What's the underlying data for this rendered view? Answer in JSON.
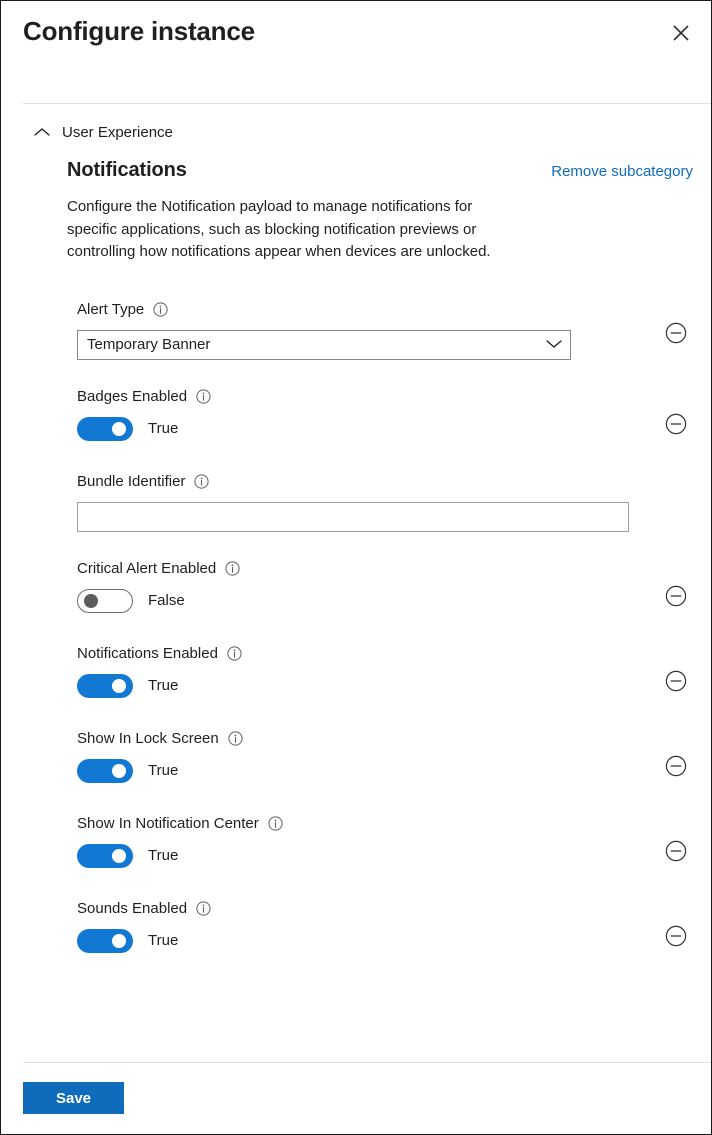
{
  "panel": {
    "title": "Configure instance",
    "close_icon": "close-icon"
  },
  "category": {
    "label": "User Experience",
    "collapse_icon": "chevron-up-icon",
    "expanded": true
  },
  "subcategory": {
    "title": "Notifications",
    "remove_link": "Remove subcategory",
    "description": "Configure the Notification payload to manage notifications for specific applications, such as blocking notification previews or controlling how notifications appear when devices are unlocked."
  },
  "settings": [
    {
      "label": "Alert Type",
      "info_icon": "info-icon",
      "type": "dropdown",
      "value": "Temporary Banner",
      "chevron_icon": "chevron-down-icon",
      "removable": true,
      "remove_icon": "circle-minus-icon"
    },
    {
      "label": "Badges Enabled",
      "info_icon": "info-icon",
      "type": "toggle",
      "value": "True",
      "on": true,
      "removable": true,
      "remove_icon": "circle-minus-icon"
    },
    {
      "label": "Bundle Identifier",
      "info_icon": "info-icon",
      "type": "text",
      "value": "",
      "placeholder": "",
      "removable": false
    },
    {
      "label": "Critical Alert Enabled",
      "info_icon": "info-icon",
      "type": "toggle",
      "value": "False",
      "on": false,
      "removable": true,
      "remove_icon": "circle-minus-icon"
    },
    {
      "label": "Notifications Enabled",
      "info_icon": "info-icon",
      "type": "toggle",
      "value": "True",
      "on": true,
      "removable": true,
      "remove_icon": "circle-minus-icon"
    },
    {
      "label": "Show In Lock Screen",
      "info_icon": "info-icon",
      "type": "toggle",
      "value": "True",
      "on": true,
      "removable": true,
      "remove_icon": "circle-minus-icon"
    },
    {
      "label": "Show In Notification Center",
      "info_icon": "info-icon",
      "type": "toggle",
      "value": "True",
      "on": true,
      "removable": true,
      "remove_icon": "circle-minus-icon"
    },
    {
      "label": "Sounds Enabled",
      "info_icon": "info-icon",
      "type": "toggle",
      "value": "True",
      "on": true,
      "removable": true,
      "remove_icon": "circle-minus-icon"
    }
  ],
  "footer": {
    "save_label": "Save"
  },
  "colors": {
    "accent": "#0f6cbd",
    "toggle_on": "#1178d4",
    "link": "#0f6cbd",
    "text": "#201f1e",
    "divider": "#e1e1e1"
  }
}
